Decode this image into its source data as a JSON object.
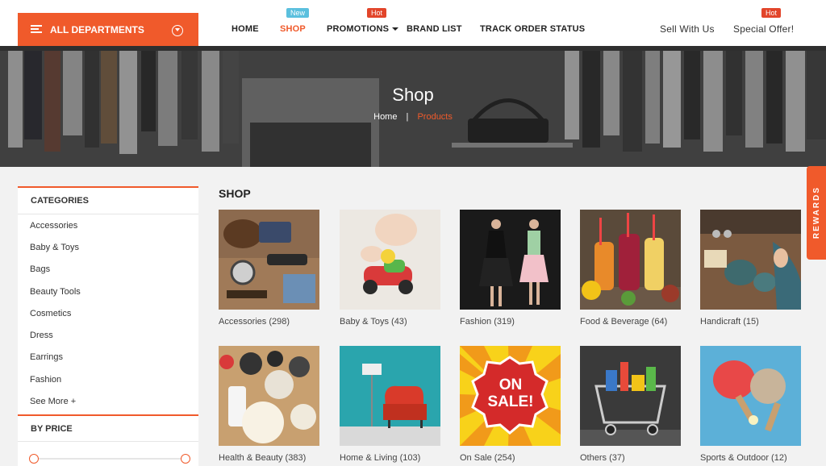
{
  "header": {
    "departments_label": "ALL DEPARTMENTS",
    "nav": [
      {
        "label": "HOME"
      },
      {
        "label": "SHOP",
        "tag": "New"
      },
      {
        "label": "PROMOTIONS",
        "tag": "Hot"
      },
      {
        "label": "BRAND LIST"
      },
      {
        "label": "TRACK ORDER STATUS"
      }
    ],
    "sell_with_us": "Sell With Us",
    "special_offer": "Special Offer!",
    "special_offer_tag": "Hot"
  },
  "hero": {
    "title": "Shop",
    "breadcrumb_home": "Home",
    "breadcrumb_separator": "|",
    "breadcrumb_current": "Products"
  },
  "rewards_label": "REWARDS",
  "sidebar": {
    "categories_title": "CATEGORIES",
    "categories": [
      "Accessories",
      "Baby & Toys",
      "Bags",
      "Beauty Tools",
      "Cosmetics",
      "Dress",
      "Earrings",
      "Fashion",
      "See More +"
    ],
    "price_title": "BY PRICE",
    "price_range": {
      "min_fraction": 0.0,
      "max_fraction": 1.0
    }
  },
  "main": {
    "title": "SHOP",
    "products": [
      {
        "name": "Accessories",
        "count": "298"
      },
      {
        "name": "Baby & Toys",
        "count": "43"
      },
      {
        "name": "Fashion",
        "count": "319"
      },
      {
        "name": "Food & Beverage",
        "count": "64"
      },
      {
        "name": "Handicraft",
        "count": "15"
      },
      {
        "name": "Health & Beauty",
        "count": "383"
      },
      {
        "name": "Home & Living",
        "count": "103"
      },
      {
        "name": "On Sale",
        "count": "254"
      },
      {
        "name": "Others",
        "count": "37"
      },
      {
        "name": "Sports & Outdoor",
        "count": "12"
      }
    ],
    "sale_badge_text": "ON SALE!"
  },
  "colors": {
    "accent": "#f05a2b",
    "new_tag": "#5bc0de",
    "hot_tag": "#e2452a"
  }
}
